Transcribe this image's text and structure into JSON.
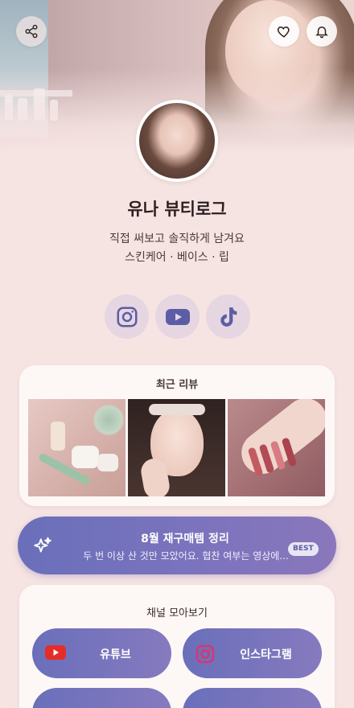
{
  "profile": {
    "name": "유나 뷰티로그",
    "bio_line1": "직접 써보고 솔직하게 남겨요",
    "bio_line2": "스킨케어 · 베이스 · 립"
  },
  "socials": [
    {
      "icon": "instagram-icon"
    },
    {
      "icon": "youtube-icon"
    },
    {
      "icon": "tiktok-icon"
    }
  ],
  "reviews": {
    "title": "최근 리뷰"
  },
  "banner": {
    "title": "8월 재구매템 정리",
    "subtitle": "두 번 이상 산 것만 모았어요. 협찬 여부는 영상에...",
    "badge": "BEST"
  },
  "channels": {
    "title": "채널 모아보기",
    "items": [
      {
        "label": "유튜브",
        "icon": "youtube-icon"
      },
      {
        "label": "인스타그램",
        "icon": "instagram-icon"
      }
    ]
  },
  "colors": {
    "background": "#f6e4e3",
    "accent_start": "#6a6fba",
    "accent_end": "#8a77bc",
    "social_bg": "#e6d6e1",
    "youtube_red": "#e52d27",
    "instagram_pink": "#d8356e"
  }
}
